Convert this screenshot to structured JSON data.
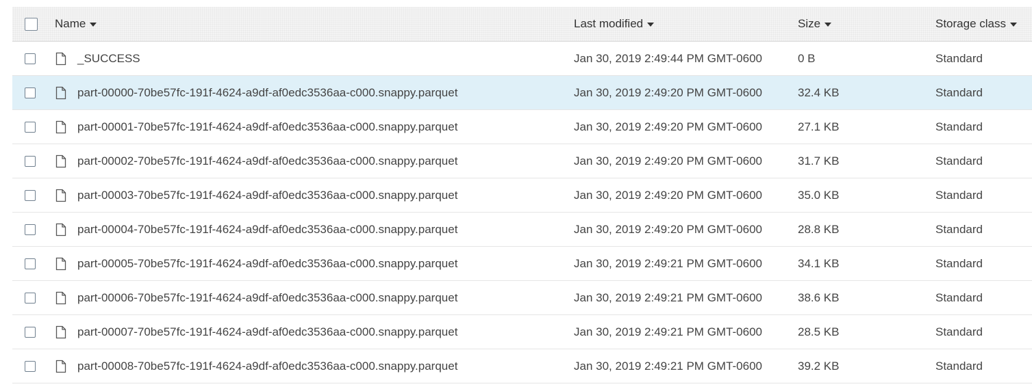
{
  "columns": {
    "name": "Name",
    "last_modified": "Last modified",
    "size": "Size",
    "storage_class": "Storage class"
  },
  "icons": {
    "header_select": "checkbox-icon",
    "sort": "caret-down-icon",
    "file": "file-icon"
  },
  "colors": {
    "selected_row": "#dff0f8",
    "header_bg": "#f4f4f4",
    "text": "#444444"
  },
  "rows": [
    {
      "name": "_SUCCESS",
      "last_modified": "Jan 30, 2019 2:49:44 PM GMT-0600",
      "size": "0 B",
      "storage_class": "Standard",
      "selected": false
    },
    {
      "name": "part-00000-70be57fc-191f-4624-a9df-af0edc3536aa-c000.snappy.parquet",
      "last_modified": "Jan 30, 2019 2:49:20 PM GMT-0600",
      "size": "32.4 KB",
      "storage_class": "Standard",
      "selected": true
    },
    {
      "name": "part-00001-70be57fc-191f-4624-a9df-af0edc3536aa-c000.snappy.parquet",
      "last_modified": "Jan 30, 2019 2:49:20 PM GMT-0600",
      "size": "27.1 KB",
      "storage_class": "Standard",
      "selected": false
    },
    {
      "name": "part-00002-70be57fc-191f-4624-a9df-af0edc3536aa-c000.snappy.parquet",
      "last_modified": "Jan 30, 2019 2:49:20 PM GMT-0600",
      "size": "31.7 KB",
      "storage_class": "Standard",
      "selected": false
    },
    {
      "name": "part-00003-70be57fc-191f-4624-a9df-af0edc3536aa-c000.snappy.parquet",
      "last_modified": "Jan 30, 2019 2:49:20 PM GMT-0600",
      "size": "35.0 KB",
      "storage_class": "Standard",
      "selected": false
    },
    {
      "name": "part-00004-70be57fc-191f-4624-a9df-af0edc3536aa-c000.snappy.parquet",
      "last_modified": "Jan 30, 2019 2:49:20 PM GMT-0600",
      "size": "28.8 KB",
      "storage_class": "Standard",
      "selected": false
    },
    {
      "name": "part-00005-70be57fc-191f-4624-a9df-af0edc3536aa-c000.snappy.parquet",
      "last_modified": "Jan 30, 2019 2:49:21 PM GMT-0600",
      "size": "34.1 KB",
      "storage_class": "Standard",
      "selected": false
    },
    {
      "name": "part-00006-70be57fc-191f-4624-a9df-af0edc3536aa-c000.snappy.parquet",
      "last_modified": "Jan 30, 2019 2:49:21 PM GMT-0600",
      "size": "38.6 KB",
      "storage_class": "Standard",
      "selected": false
    },
    {
      "name": "part-00007-70be57fc-191f-4624-a9df-af0edc3536aa-c000.snappy.parquet",
      "last_modified": "Jan 30, 2019 2:49:21 PM GMT-0600",
      "size": "28.5 KB",
      "storage_class": "Standard",
      "selected": false
    },
    {
      "name": "part-00008-70be57fc-191f-4624-a9df-af0edc3536aa-c000.snappy.parquet",
      "last_modified": "Jan 30, 2019 2:49:21 PM GMT-0600",
      "size": "39.2 KB",
      "storage_class": "Standard",
      "selected": false
    }
  ]
}
